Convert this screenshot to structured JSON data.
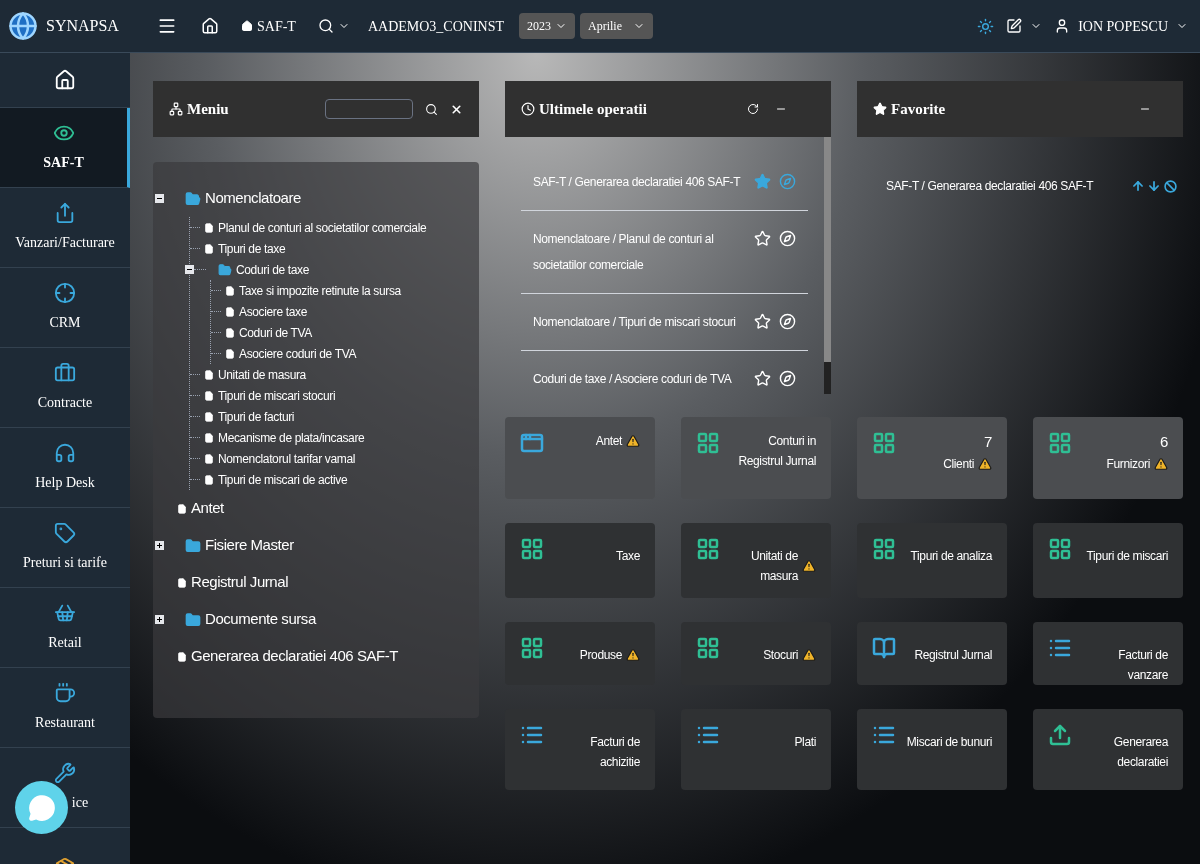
{
  "topbar": {
    "brand": "SYNAPSA",
    "module": "SAF-T",
    "company": "AADEMO3_CONINST",
    "year": "2023",
    "month": "Aprilie",
    "user": "ION POPESCU"
  },
  "sidebar": {
    "items": [
      {
        "selected": false
      },
      {
        "label": "SAF-T",
        "selected": true
      },
      {
        "label": "Vanzari/Facturare",
        "selected": false
      },
      {
        "label": "CRM",
        "selected": false
      },
      {
        "label": "Contracte",
        "selected": false
      },
      {
        "label": "Help Desk",
        "selected": false
      },
      {
        "label": "Preturi si tarife",
        "selected": false
      },
      {
        "label": "Retail",
        "selected": false
      },
      {
        "label": "Restaurant",
        "selected": false
      },
      {
        "label": "ice",
        "selected": false
      },
      {
        "selected": false
      }
    ]
  },
  "menu_panel": {
    "title": "Meniu",
    "tree": [
      {
        "kind": "folder",
        "label": "Nomenclatoare",
        "expanded": true,
        "children": [
          {
            "kind": "file",
            "label": "Planul de conturi al societatilor comerciale"
          },
          {
            "kind": "file",
            "label": "Tipuri de taxe"
          },
          {
            "kind": "folder",
            "label": "Coduri de taxe",
            "expanded": true,
            "children": [
              {
                "kind": "file",
                "label": "Taxe si impozite retinute la sursa"
              },
              {
                "kind": "file",
                "label": "Asociere taxe"
              },
              {
                "kind": "file",
                "label": "Coduri de TVA"
              },
              {
                "kind": "file",
                "label": "Asociere coduri de TVA"
              }
            ]
          },
          {
            "kind": "file",
            "label": "Unitati de masura"
          },
          {
            "kind": "file",
            "label": "Tipuri de miscari stocuri"
          },
          {
            "kind": "file",
            "label": "Tipuri de facturi"
          },
          {
            "kind": "file",
            "label": "Mecanisme de plata/incasare"
          },
          {
            "kind": "file",
            "label": "Nomenclatorul tarifar vamal"
          },
          {
            "kind": "file",
            "label": "Tipuri de miscari de active"
          }
        ]
      },
      {
        "kind": "file",
        "label": "Antet"
      },
      {
        "kind": "folder",
        "label": "Fisiere Master",
        "expanded": false
      },
      {
        "kind": "file",
        "label": "Registrul Jurnal"
      },
      {
        "kind": "folder",
        "label": "Documente sursa",
        "expanded": false
      },
      {
        "kind": "file",
        "label": "Generarea declaratiei 406 SAF-T"
      }
    ]
  },
  "recent_panel": {
    "title": "Ultimele operatii",
    "items": [
      {
        "label": "SAF-T / Generarea declaratiei 406 SAF-T",
        "favorite": true
      },
      {
        "label": "Nomenclatoare / Planul de conturi al societatilor comerciale",
        "favorite": false
      },
      {
        "label": "Nomenclatoare / Tipuri de miscari stocuri",
        "favorite": false
      },
      {
        "label": "Coduri de taxe / Asociere coduri de TVA",
        "favorite": false
      }
    ]
  },
  "favorites_panel": {
    "title": "Favorite",
    "items": [
      {
        "label": "SAF-T / Generarea declaratiei 406 SAF-T"
      }
    ]
  },
  "tiles": [
    {
      "kind": "window",
      "label": "Antet",
      "warning": true
    },
    {
      "kind": "grid",
      "label": "Conturi in Registrul Jurnal",
      "warning": false
    },
    {
      "kind": "grid",
      "label": "Clienti",
      "count": "7",
      "warning": true
    },
    {
      "kind": "grid",
      "label": "Furnizori",
      "count": "6",
      "warning": true
    },
    {
      "kind": "grid",
      "label": "Taxe",
      "warning": false
    },
    {
      "kind": "grid",
      "label": "Unitati de masura",
      "warning": true
    },
    {
      "kind": "grid",
      "label": "Tipuri de analiza",
      "warning": false
    },
    {
      "kind": "grid",
      "label": "Tipuri de miscari",
      "warning": false
    },
    {
      "kind": "grid",
      "label": "Produse",
      "warning": true
    },
    {
      "kind": "grid",
      "label": "Stocuri",
      "warning": true
    },
    {
      "kind": "book",
      "label": "Registrul Jurnal",
      "warning": false
    },
    {
      "kind": "list",
      "label": "Facturi de vanzare",
      "warning": false
    },
    {
      "kind": "list",
      "label": "Facturi de achizitie",
      "warning": false
    },
    {
      "kind": "list",
      "label": "Plati",
      "warning": false
    },
    {
      "kind": "list",
      "label": "Miscari de bunuri",
      "warning": false
    },
    {
      "kind": "upload",
      "label": "Generarea declaratiei",
      "warning": false
    }
  ]
}
